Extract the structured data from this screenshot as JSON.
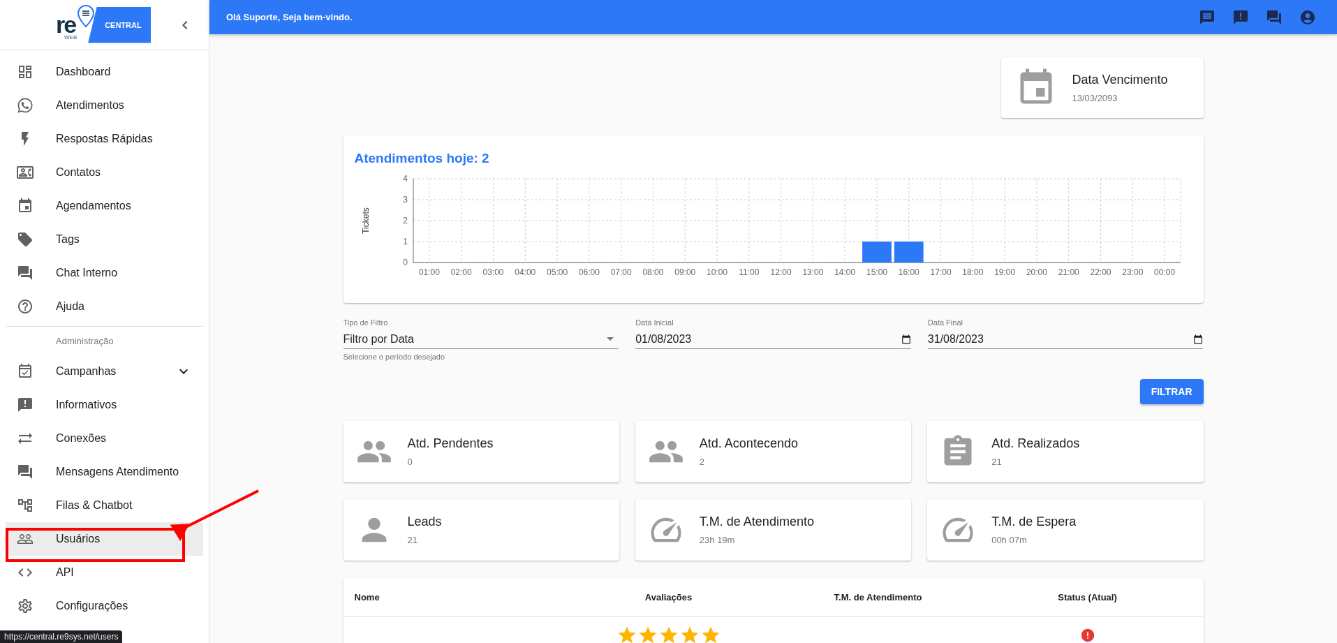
{
  "sidebar": {
    "logo": {
      "mark": "re",
      "sub": "WEB",
      "product": "CENTRAL"
    },
    "items": [
      {
        "label": "Dashboard",
        "selected": false
      },
      {
        "label": "Atendimentos",
        "selected": false
      },
      {
        "label": "Respostas Rápidas",
        "selected": false
      },
      {
        "label": "Contatos",
        "selected": false
      },
      {
        "label": "Agendamentos",
        "selected": false
      },
      {
        "label": "Tags",
        "selected": false
      },
      {
        "label": "Chat Interno",
        "selected": false
      },
      {
        "label": "Ajuda",
        "selected": false
      }
    ],
    "admin": {
      "heading": "Administração",
      "items": [
        {
          "label": "Campanhas",
          "selected": false,
          "expanded": false
        },
        {
          "label": "Informativos",
          "selected": false
        },
        {
          "label": "Conexões",
          "selected": false
        },
        {
          "label": "Mensagens Atendimento",
          "selected": false
        },
        {
          "label": "Filas & Chatbot",
          "selected": false
        },
        {
          "label": "Usuários",
          "selected": true
        },
        {
          "label": "API",
          "selected": false
        },
        {
          "label": "Configurações",
          "selected": false
        }
      ]
    }
  },
  "header": {
    "greeting": "Olá Suporte, Seja bem-vindo."
  },
  "due_card": {
    "title": "Data Vencimento",
    "value": "13/03/2093"
  },
  "chart": {
    "title": "Atendimentos hoje: 2",
    "chart_data": {
      "type": "bar",
      "ylabel": "Tickets",
      "categories": [
        "01:00",
        "02:00",
        "03:00",
        "04:00",
        "05:00",
        "06:00",
        "07:00",
        "08:00",
        "09:00",
        "10:00",
        "11:00",
        "12:00",
        "13:00",
        "14:00",
        "15:00",
        "16:00",
        "17:00",
        "18:00",
        "19:00",
        "20:00",
        "21:00",
        "22:00",
        "23:00",
        "00:00"
      ],
      "grid": true,
      "series": [
        {
          "color": "#2c78f6",
          "values": [
            0,
            0,
            0,
            0,
            0,
            0,
            0,
            0,
            0,
            0,
            0,
            0,
            0,
            0,
            1,
            1,
            0,
            0,
            0,
            0,
            0,
            0,
            0,
            0
          ]
        }
      ],
      "ylim": [
        0,
        4
      ],
      "yticks": [
        0,
        1,
        2,
        3,
        4
      ]
    }
  },
  "filters": {
    "type": {
      "label": "Tipo de Filtro",
      "value": "Filtro por Data",
      "helper": "Selecione o período desejado"
    },
    "start": {
      "label": "Data Inicial",
      "value": "01/08/2023"
    },
    "end": {
      "label": "Data Final",
      "value": "31/08/2023"
    },
    "button": "FILTRAR"
  },
  "stats": [
    {
      "title": "Atd. Pendentes",
      "value": "0"
    },
    {
      "title": "Atd. Acontecendo",
      "value": "2"
    },
    {
      "title": "Atd. Realizados",
      "value": "21"
    },
    {
      "title": "Leads",
      "value": "21"
    },
    {
      "title": "T.M. de Atendimento",
      "value": "23h 19m"
    },
    {
      "title": "T.M. de Espera",
      "value": "00h 07m"
    }
  ],
  "table": {
    "columns": [
      "Nome",
      "Avaliações",
      "T.M. de Atendimento",
      "Status (Atual)"
    ],
    "rows": [
      {
        "stars": 5
      }
    ]
  },
  "status_tooltip": "https://central.re9sys.net/users"
}
